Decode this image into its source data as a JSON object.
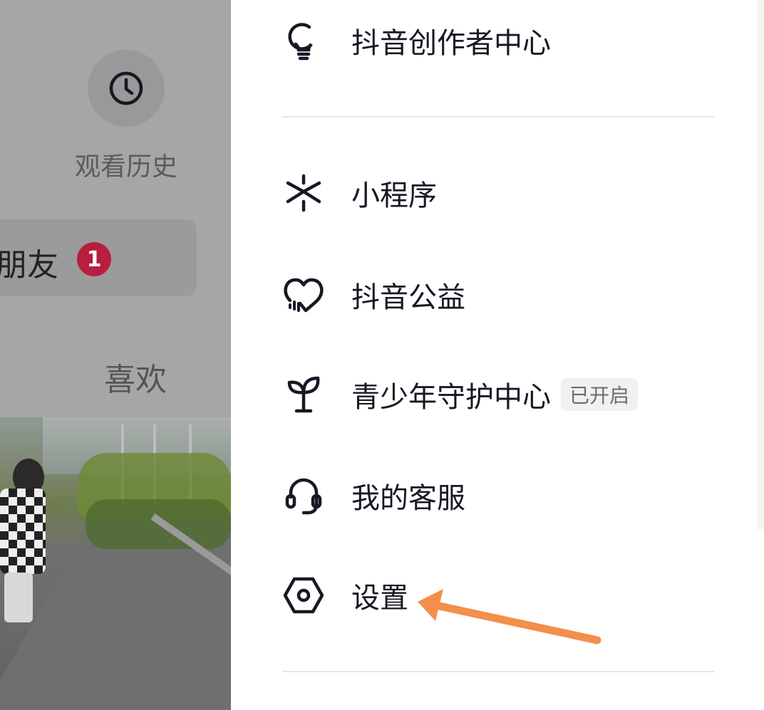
{
  "left_panel": {
    "history_label": "观看历史",
    "friends_label": "朋友",
    "friends_badge_count": "1",
    "likes_tab_label": "喜欢"
  },
  "menu": {
    "items": [
      {
        "label": "抖音创作者中心",
        "icon": "lightbulb-icon"
      },
      {
        "label": "小程序",
        "icon": "mini-program-icon"
      },
      {
        "label": "抖音公益",
        "icon": "charity-heart-icon"
      },
      {
        "label": "青少年守护中心",
        "icon": "sprout-icon",
        "status": "已开启"
      },
      {
        "label": "我的客服",
        "icon": "headset-icon"
      },
      {
        "label": "设置",
        "icon": "settings-hexagon-icon"
      }
    ]
  },
  "colors": {
    "badge": "#b81e3d",
    "arrow": "#f28f4a",
    "overlay": "#a6a6a6"
  }
}
